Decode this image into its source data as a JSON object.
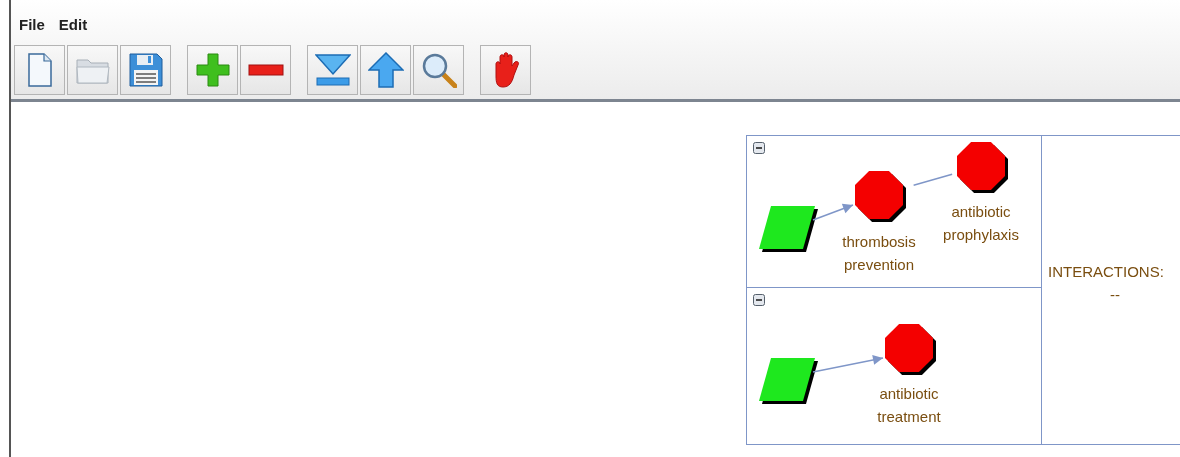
{
  "menu": [
    {
      "label": "File"
    },
    {
      "label": "Edit"
    }
  ],
  "diagram": {
    "panels": [
      {
        "expanded": true,
        "nodes": [
          {
            "kind": "start"
          },
          {
            "kind": "action",
            "label": "thrombosis prevention",
            "arrowhead": true
          },
          {
            "kind": "action",
            "label": "antibiotic prophylaxis",
            "arrowhead": false
          }
        ]
      },
      {
        "expanded": true,
        "nodes": [
          {
            "kind": "start"
          },
          {
            "kind": "action",
            "label": "antibiotic treatment",
            "arrowhead": true
          }
        ]
      }
    ],
    "interactions": {
      "title": "INTERACTIONS:",
      "value": "--"
    }
  }
}
